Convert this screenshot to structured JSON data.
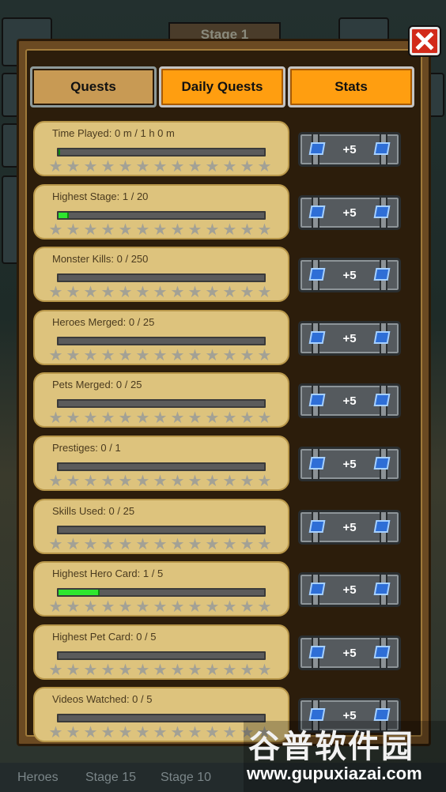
{
  "background": {
    "title": "Stage 1",
    "bottom_items": [
      "Heroes",
      "Stage 15",
      "Stage 10"
    ]
  },
  "tabs": [
    {
      "label": "Quests",
      "active": true
    },
    {
      "label": "Daily Quests",
      "active": false
    },
    {
      "label": "Stats",
      "active": false
    }
  ],
  "quests": [
    {
      "label": "Time Played: 0 m / 1 h 0 m",
      "progress": 0.005,
      "reward": "+5"
    },
    {
      "label": "Highest Stage: 1 / 20",
      "progress": 0.05,
      "reward": "+5"
    },
    {
      "label": "Monster Kills: 0 / 250",
      "progress": 0,
      "reward": "+5"
    },
    {
      "label": "Heroes Merged: 0 / 25",
      "progress": 0,
      "reward": "+5"
    },
    {
      "label": "Pets Merged: 0 / 25",
      "progress": 0,
      "reward": "+5"
    },
    {
      "label": "Prestiges: 0 / 1",
      "progress": 0,
      "reward": "+5"
    },
    {
      "label": "Skills Used: 0 / 25",
      "progress": 0,
      "reward": "+5"
    },
    {
      "label": "Highest Hero Card: 1 / 5",
      "progress": 0.2,
      "reward": "+5"
    },
    {
      "label": "Highest Pet Card: 0 / 5",
      "progress": 0,
      "reward": "+5"
    },
    {
      "label": "Videos Watched: 0 / 5",
      "progress": 0,
      "reward": "+5"
    }
  ],
  "stars_per_row": 13,
  "icons": {
    "close": "close-icon",
    "gem": "gem-icon",
    "star": "star-icon"
  },
  "colors": {
    "accent": "#ff9e10",
    "progress": "#2ee62e",
    "close": "#d22a1a"
  },
  "watermark": {
    "cn": "谷普软件园",
    "en": "www.gupuxiazai.com"
  }
}
